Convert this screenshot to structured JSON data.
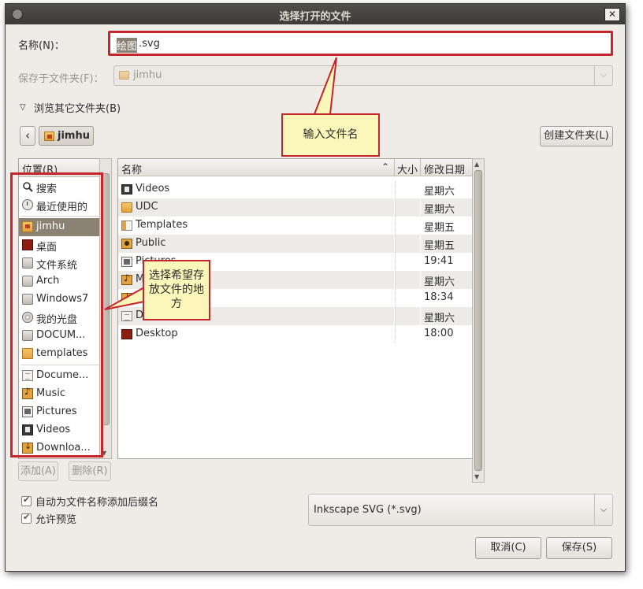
{
  "window": {
    "title": "选择打开的文件",
    "close_glyph": "✕"
  },
  "name_row": {
    "label": "名称(N)：",
    "value_selected": "绘图",
    "value_rest": ".svg"
  },
  "save_in": {
    "label": "保存于文件夹(F)：",
    "value": "jimhu"
  },
  "browse": {
    "label": "浏览其它文件夹(B)"
  },
  "path_bar": {
    "back_glyph": "‹",
    "current": "jimhu"
  },
  "create_folder": {
    "label": "创建文件夹(L)"
  },
  "places": {
    "header": "位置(R)",
    "items": [
      {
        "label": "搜索",
        "icon": "search-icon"
      },
      {
        "label": "最近使用的",
        "icon": "clock-icon"
      },
      {
        "label": "jimhu",
        "icon": "home-folder-icon",
        "selected": true
      },
      {
        "label": "桌面",
        "icon": "desktop-icon"
      },
      {
        "label": "文件系统",
        "icon": "drive-icon"
      },
      {
        "label": "Arch",
        "icon": "drive-icon"
      },
      {
        "label": "Windows7",
        "icon": "drive-icon"
      },
      {
        "label": "我的光盘",
        "icon": "disc-icon"
      },
      {
        "label": "DOCUM...",
        "icon": "drive-icon"
      },
      {
        "label": "templates",
        "icon": "folder-icon"
      },
      {
        "label": "Docume...",
        "icon": "documents-icon"
      },
      {
        "label": "Music",
        "icon": "music-icon"
      },
      {
        "label": "Pictures",
        "icon": "pictures-icon"
      },
      {
        "label": "Videos",
        "icon": "videos-icon"
      },
      {
        "label": "Downloa...",
        "icon": "downloads-icon"
      }
    ]
  },
  "places_buttons": {
    "add": "添加(A)",
    "remove": "删除(R)"
  },
  "files": {
    "headers": {
      "name": "名称",
      "size": "大小",
      "modified": "修改日期",
      "sort_glyph": "⌃"
    },
    "rows": [
      {
        "name": "Videos",
        "modified": "星期六",
        "icon": "videos-icon"
      },
      {
        "name": "UDC",
        "modified": "星期六",
        "icon": "folder-icon"
      },
      {
        "name": "Templates",
        "modified": "星期五",
        "icon": "templates-icon"
      },
      {
        "name": "Public",
        "modified": "星期五",
        "icon": "public-icon"
      },
      {
        "name": "Pictures",
        "modified": "19:41",
        "icon": "pictures-icon"
      },
      {
        "name": "M",
        "modified": "星期六",
        "icon": "music-icon"
      },
      {
        "name": "",
        "modified": "18:34",
        "icon": "downloads-icon"
      },
      {
        "name": "D",
        "modified": "星期六",
        "icon": "documents-icon"
      },
      {
        "name": "Desktop",
        "modified": "18:00",
        "icon": "desktop-icon"
      }
    ]
  },
  "callouts": {
    "filename": "输入文件名",
    "location": "选择希望存放文件的地方"
  },
  "options": {
    "auto_ext": "自动为文件名称添加后缀名",
    "preview": "允许预览"
  },
  "filter": {
    "value": "Inkscape SVG (*.svg)"
  },
  "actions": {
    "cancel": "取消(C)",
    "save": "保存(S)"
  },
  "colors": {
    "annotation_red": "#c4262b",
    "callout_fill": "#fbf6b9",
    "selection": "#8b8273"
  }
}
